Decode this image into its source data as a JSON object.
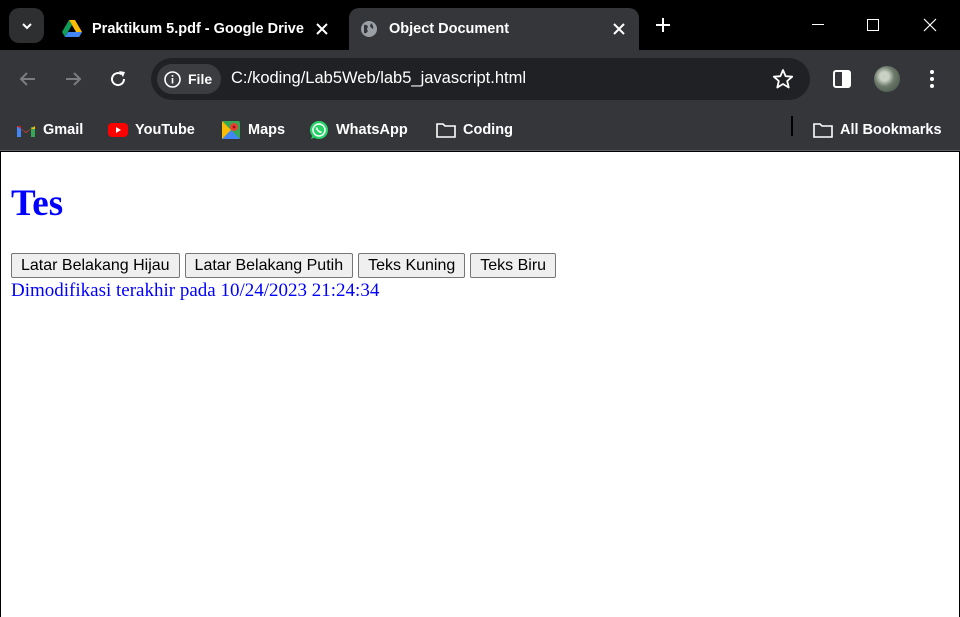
{
  "browser": {
    "tabs": [
      {
        "title": "Praktikum 5.pdf - Google Drive",
        "favicon": "google-drive-icon",
        "active": false
      },
      {
        "title": "Object Document",
        "favicon": "globe-icon",
        "active": true
      }
    ],
    "address_bar": {
      "security_chip": "File",
      "url": "C:/koding/Lab5Web/lab5_javascript.html"
    },
    "bookmarks": [
      {
        "label": "Gmail",
        "icon": "gmail-icon"
      },
      {
        "label": "YouTube",
        "icon": "youtube-icon"
      },
      {
        "label": "Maps",
        "icon": "maps-icon"
      },
      {
        "label": "WhatsApp",
        "icon": "whatsapp-icon"
      },
      {
        "label": "Coding",
        "icon": "folder-icon"
      }
    ],
    "all_bookmarks": "All Bookmarks"
  },
  "page": {
    "heading": "Tes",
    "heading_color": "#0000ff",
    "buttons": [
      "Latar Belakang Hijau",
      "Latar Belakang Putih",
      "Teks Kuning",
      "Teks Biru"
    ],
    "last_modified": "Dimodifikasi terakhir pada 10/24/2023 21:24:34"
  }
}
